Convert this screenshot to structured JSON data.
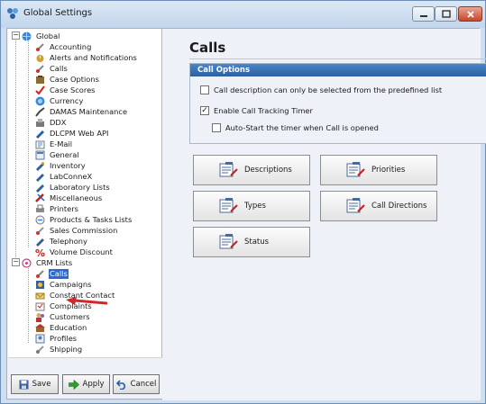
{
  "window": {
    "title": "Global Settings",
    "accent": "#2a6ad0",
    "min_symbol": "—",
    "max_symbol": "□",
    "close_symbol": "✕"
  },
  "tree": {
    "groups": [
      {
        "label": "Global",
        "expander": "−",
        "icon": "globe-icon"
      },
      {
        "label": "CRM Lists",
        "expander": "−",
        "icon": "crm-icon"
      }
    ],
    "global_items": [
      {
        "label": "Accounting",
        "icon": "accounting-icon"
      },
      {
        "label": "Alerts and Notifications",
        "icon": "alerts-icon"
      },
      {
        "label": "Calls",
        "icon": "calls-icon"
      },
      {
        "label": "Case Options",
        "icon": "case-options-icon"
      },
      {
        "label": "Case Scores",
        "icon": "case-scores-icon"
      },
      {
        "label": "Currency",
        "icon": "currency-icon"
      },
      {
        "label": "DAMAS Maintenance",
        "icon": "damas-icon"
      },
      {
        "label": "DDX",
        "icon": "ddx-icon"
      },
      {
        "label": "DLCPM Web API",
        "icon": "web-api-icon"
      },
      {
        "label": "E-Mail",
        "icon": "email-icon"
      },
      {
        "label": "General",
        "icon": "general-icon"
      },
      {
        "label": "Inventory",
        "icon": "inventory-icon"
      },
      {
        "label": "LabConneX",
        "icon": "labconnex-icon"
      },
      {
        "label": "Laboratory Lists",
        "icon": "lab-lists-icon"
      },
      {
        "label": "Miscellaneous",
        "icon": "misc-icon"
      },
      {
        "label": "Printers",
        "icon": "printer-icon"
      },
      {
        "label": "Products & Tasks Lists",
        "icon": "products-icon"
      },
      {
        "label": "Sales Commission",
        "icon": "commission-icon"
      },
      {
        "label": "Telephony",
        "icon": "telephony-icon"
      },
      {
        "label": "Volume Discount",
        "icon": "percent-icon"
      }
    ],
    "crm_items": [
      {
        "label": "Calls",
        "icon": "calls-icon",
        "selected": true
      },
      {
        "label": "Campaigns",
        "icon": "campaigns-icon"
      },
      {
        "label": "Constant Contact",
        "icon": "constant-contact-icon"
      },
      {
        "label": "Complaints",
        "icon": "complaints-icon"
      },
      {
        "label": "Customers",
        "icon": "customers-icon"
      },
      {
        "label": "Education",
        "icon": "education-icon"
      },
      {
        "label": "Profiles",
        "icon": "profiles-icon"
      },
      {
        "label": "Shipping",
        "icon": "shipping-icon"
      }
    ]
  },
  "footer": {
    "save_label": "Save",
    "apply_label": "Apply",
    "cancel_label": "Cancel"
  },
  "main": {
    "title": "Calls",
    "options_header": "Call Options",
    "options": [
      {
        "label": "Call description can only be selected from the predefined list",
        "checked": false,
        "mark": ""
      },
      {
        "label": "Enable Call Tracking Timer",
        "checked": true,
        "mark": "✓"
      },
      {
        "label": "Auto-Start the timer when Call is opened",
        "checked": false,
        "mark": ""
      }
    ],
    "buttons": [
      {
        "label": "Descriptions"
      },
      {
        "label": "Priorities"
      },
      {
        "label": "Types"
      },
      {
        "label": "Call Directions"
      },
      {
        "label": "Status"
      }
    ]
  }
}
